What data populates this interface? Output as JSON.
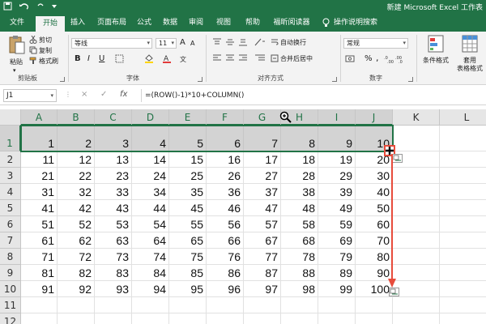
{
  "window": {
    "title": "新建 Microsoft Excel 工作表"
  },
  "ribbon": {
    "tabs": [
      {
        "label": "文件"
      },
      {
        "label": "开始"
      },
      {
        "label": "插入"
      },
      {
        "label": "页面布局"
      },
      {
        "label": "公式"
      },
      {
        "label": "数据"
      },
      {
        "label": "审阅"
      },
      {
        "label": "视图"
      },
      {
        "label": "帮助"
      },
      {
        "label": "福昕阅读器"
      },
      {
        "label": "操作说明搜索"
      }
    ],
    "active_tab": "开始",
    "clipboard": {
      "paste": "粘贴",
      "cut": "剪切",
      "copy": "复制",
      "format_painter": "格式刷",
      "group": "剪贴板"
    },
    "font": {
      "name": "等线",
      "size": "11",
      "group": "字体",
      "bold": "B",
      "italic": "I",
      "underline": "U",
      "grow": "A",
      "shrink": "A"
    },
    "alignment": {
      "wrap": "自动换行",
      "merge": "合并后居中",
      "group": "对齐方式"
    },
    "number": {
      "format": "常规",
      "percent": "%",
      "comma": ",",
      "group": "数字"
    },
    "styles": {
      "conditional": "条件格式",
      "table_line1": "套用",
      "table_line2": "表格格式"
    }
  },
  "formula_bar": {
    "name_box": "J1",
    "cancel": "×",
    "confirm": "✓",
    "fx": "fx",
    "formula": "=(ROW()-1)*10+COLUMN()"
  },
  "grid": {
    "columns": [
      "A",
      "B",
      "C",
      "D",
      "E",
      "F",
      "G",
      "H",
      "I",
      "J",
      "K",
      "L"
    ],
    "rows": [
      "1",
      "2",
      "3",
      "4",
      "5",
      "6",
      "7",
      "8",
      "9",
      "10",
      "11",
      "12"
    ],
    "cells": [
      [
        "1",
        "2",
        "3",
        "4",
        "5",
        "6",
        "7",
        "8",
        "9",
        "10"
      ],
      [
        "11",
        "12",
        "13",
        "14",
        "15",
        "16",
        "17",
        "18",
        "19",
        "20"
      ],
      [
        "21",
        "22",
        "23",
        "24",
        "25",
        "26",
        "27",
        "28",
        "29",
        "30"
      ],
      [
        "31",
        "32",
        "33",
        "34",
        "35",
        "36",
        "37",
        "38",
        "39",
        "40"
      ],
      [
        "41",
        "42",
        "43",
        "44",
        "45",
        "46",
        "47",
        "48",
        "49",
        "50"
      ],
      [
        "51",
        "52",
        "53",
        "54",
        "55",
        "56",
        "57",
        "58",
        "59",
        "60"
      ],
      [
        "61",
        "62",
        "63",
        "64",
        "65",
        "66",
        "67",
        "68",
        "69",
        "70"
      ],
      [
        "71",
        "72",
        "73",
        "74",
        "75",
        "76",
        "77",
        "78",
        "79",
        "80"
      ],
      [
        "81",
        "82",
        "83",
        "84",
        "85",
        "86",
        "87",
        "88",
        "89",
        "90"
      ],
      [
        "91",
        "92",
        "93",
        "94",
        "95",
        "96",
        "97",
        "98",
        "99",
        "100"
      ]
    ],
    "selection": "A1:J1",
    "colors": {
      "selection": "#217346",
      "arrow": "#e74c3c"
    }
  },
  "icons": [
    "save-icon",
    "undo-icon",
    "redo-icon",
    "cut-icon",
    "copy-icon",
    "format-painter-icon",
    "lightbulb-icon",
    "zoom-cursor-icon",
    "fill-cursor-icon",
    "smart-tag-icon",
    "drag-arrow-icon"
  ]
}
